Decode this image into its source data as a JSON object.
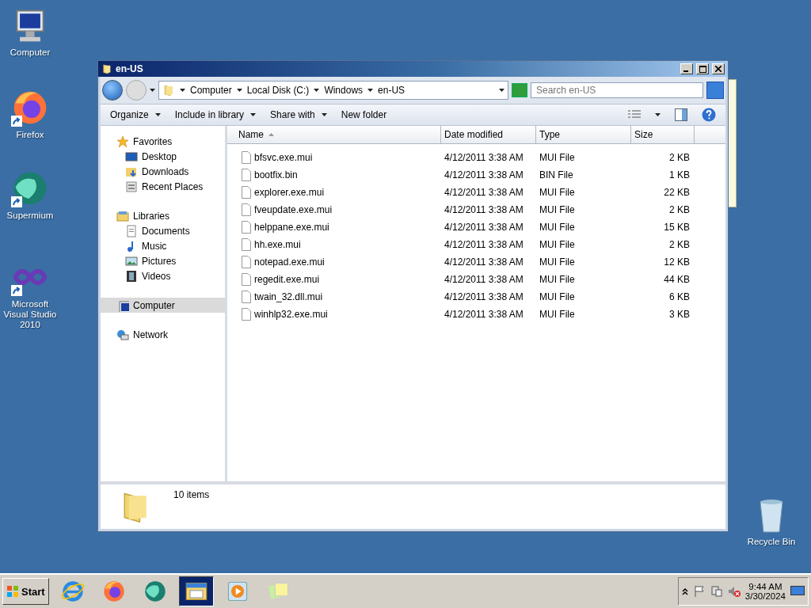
{
  "desktop_icons": [
    {
      "label": "Computer",
      "kind": "computer",
      "shortcut": false
    },
    {
      "label": "Firefox",
      "kind": "firefox",
      "shortcut": true
    },
    {
      "label": "Supermium",
      "kind": "supermium",
      "shortcut": true
    },
    {
      "label": "Microsoft Visual Studio 2010",
      "kind": "vs",
      "shortcut": true
    }
  ],
  "recycle_bin": {
    "label": "Recycle Bin"
  },
  "window": {
    "title": "en-US",
    "breadcrumb": [
      "Computer",
      "Local Disk (C:)",
      "Windows",
      "en-US"
    ],
    "search": {
      "placeholder": "Search en-US"
    },
    "toolbar": [
      {
        "label": "Organize",
        "dropdown": true
      },
      {
        "label": "Include in library",
        "dropdown": true
      },
      {
        "label": "Share with",
        "dropdown": true
      },
      {
        "label": "New folder",
        "dropdown": false
      }
    ],
    "nav": [
      {
        "label": "Favorites",
        "kind": "star",
        "selected": false,
        "children": [
          {
            "label": "Desktop",
            "kind": "desktop",
            "selected": false
          },
          {
            "label": "Downloads",
            "kind": "downloads",
            "selected": false
          },
          {
            "label": "Recent Places",
            "kind": "recent",
            "selected": false
          }
        ]
      },
      {
        "label": "Libraries",
        "kind": "library",
        "selected": false,
        "children": [
          {
            "label": "Documents",
            "kind": "documents",
            "selected": false
          },
          {
            "label": "Music",
            "kind": "music",
            "selected": false
          },
          {
            "label": "Pictures",
            "kind": "pictures",
            "selected": false
          },
          {
            "label": "Videos",
            "kind": "videos",
            "selected": false
          }
        ]
      },
      {
        "label": "Computer",
        "kind": "computer",
        "selected": true
      },
      {
        "label": "Network",
        "kind": "network",
        "selected": false
      }
    ],
    "columns": [
      {
        "label": "Name",
        "sorted": true
      },
      {
        "label": "Date modified",
        "sorted": false
      },
      {
        "label": "Type",
        "sorted": false
      },
      {
        "label": "Size",
        "sorted": false
      }
    ],
    "rows": [
      {
        "name": "bfsvc.exe.mui",
        "date": "4/12/2011 3:38 AM",
        "type": "MUI File",
        "size": "2 KB"
      },
      {
        "name": "bootfix.bin",
        "date": "4/12/2011 3:38 AM",
        "type": "BIN File",
        "size": "1 KB"
      },
      {
        "name": "explorer.exe.mui",
        "date": "4/12/2011 3:38 AM",
        "type": "MUI File",
        "size": "22 KB"
      },
      {
        "name": "fveupdate.exe.mui",
        "date": "4/12/2011 3:38 AM",
        "type": "MUI File",
        "size": "2 KB"
      },
      {
        "name": "helppane.exe.mui",
        "date": "4/12/2011 3:38 AM",
        "type": "MUI File",
        "size": "15 KB"
      },
      {
        "name": "hh.exe.mui",
        "date": "4/12/2011 3:38 AM",
        "type": "MUI File",
        "size": "2 KB"
      },
      {
        "name": "notepad.exe.mui",
        "date": "4/12/2011 3:38 AM",
        "type": "MUI File",
        "size": "12 KB"
      },
      {
        "name": "regedit.exe.mui",
        "date": "4/12/2011 3:38 AM",
        "type": "MUI File",
        "size": "44 KB"
      },
      {
        "name": "twain_32.dll.mui",
        "date": "4/12/2011 3:38 AM",
        "type": "MUI File",
        "size": "6 KB"
      },
      {
        "name": "winhlp32.exe.mui",
        "date": "4/12/2011 3:38 AM",
        "type": "MUI File",
        "size": "3 KB"
      }
    ],
    "status": "10 items"
  },
  "taskbar": {
    "start": "Start",
    "items": [
      {
        "kind": "ie",
        "active": false
      },
      {
        "kind": "firefox",
        "active": false
      },
      {
        "kind": "supermium",
        "active": false
      },
      {
        "kind": "explorer",
        "active": true
      },
      {
        "kind": "media",
        "active": false
      },
      {
        "kind": "notes",
        "active": false
      }
    ],
    "clock": {
      "time": "9:44 AM",
      "date": "3/30/2024"
    }
  }
}
